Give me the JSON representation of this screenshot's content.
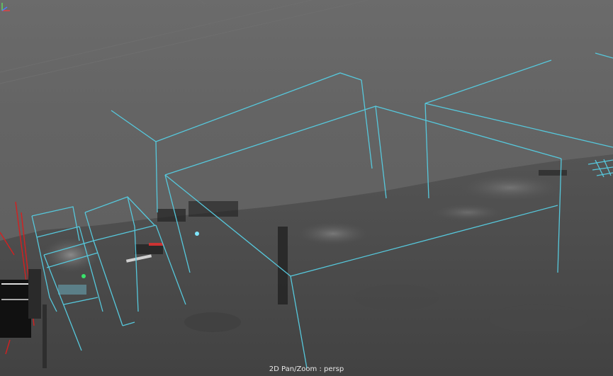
{
  "viewport": {
    "mode_label": "2D Pan/Zoom : persp",
    "colors": {
      "background": "#646464",
      "wireframe": "#56c8dc",
      "terrain": "#4a4a4a",
      "red_lines": "#d42020",
      "points_cyan": "#7fe6ff",
      "points_green": "#39e36b"
    },
    "icons": [
      "axis-gizmo-icon"
    ]
  }
}
